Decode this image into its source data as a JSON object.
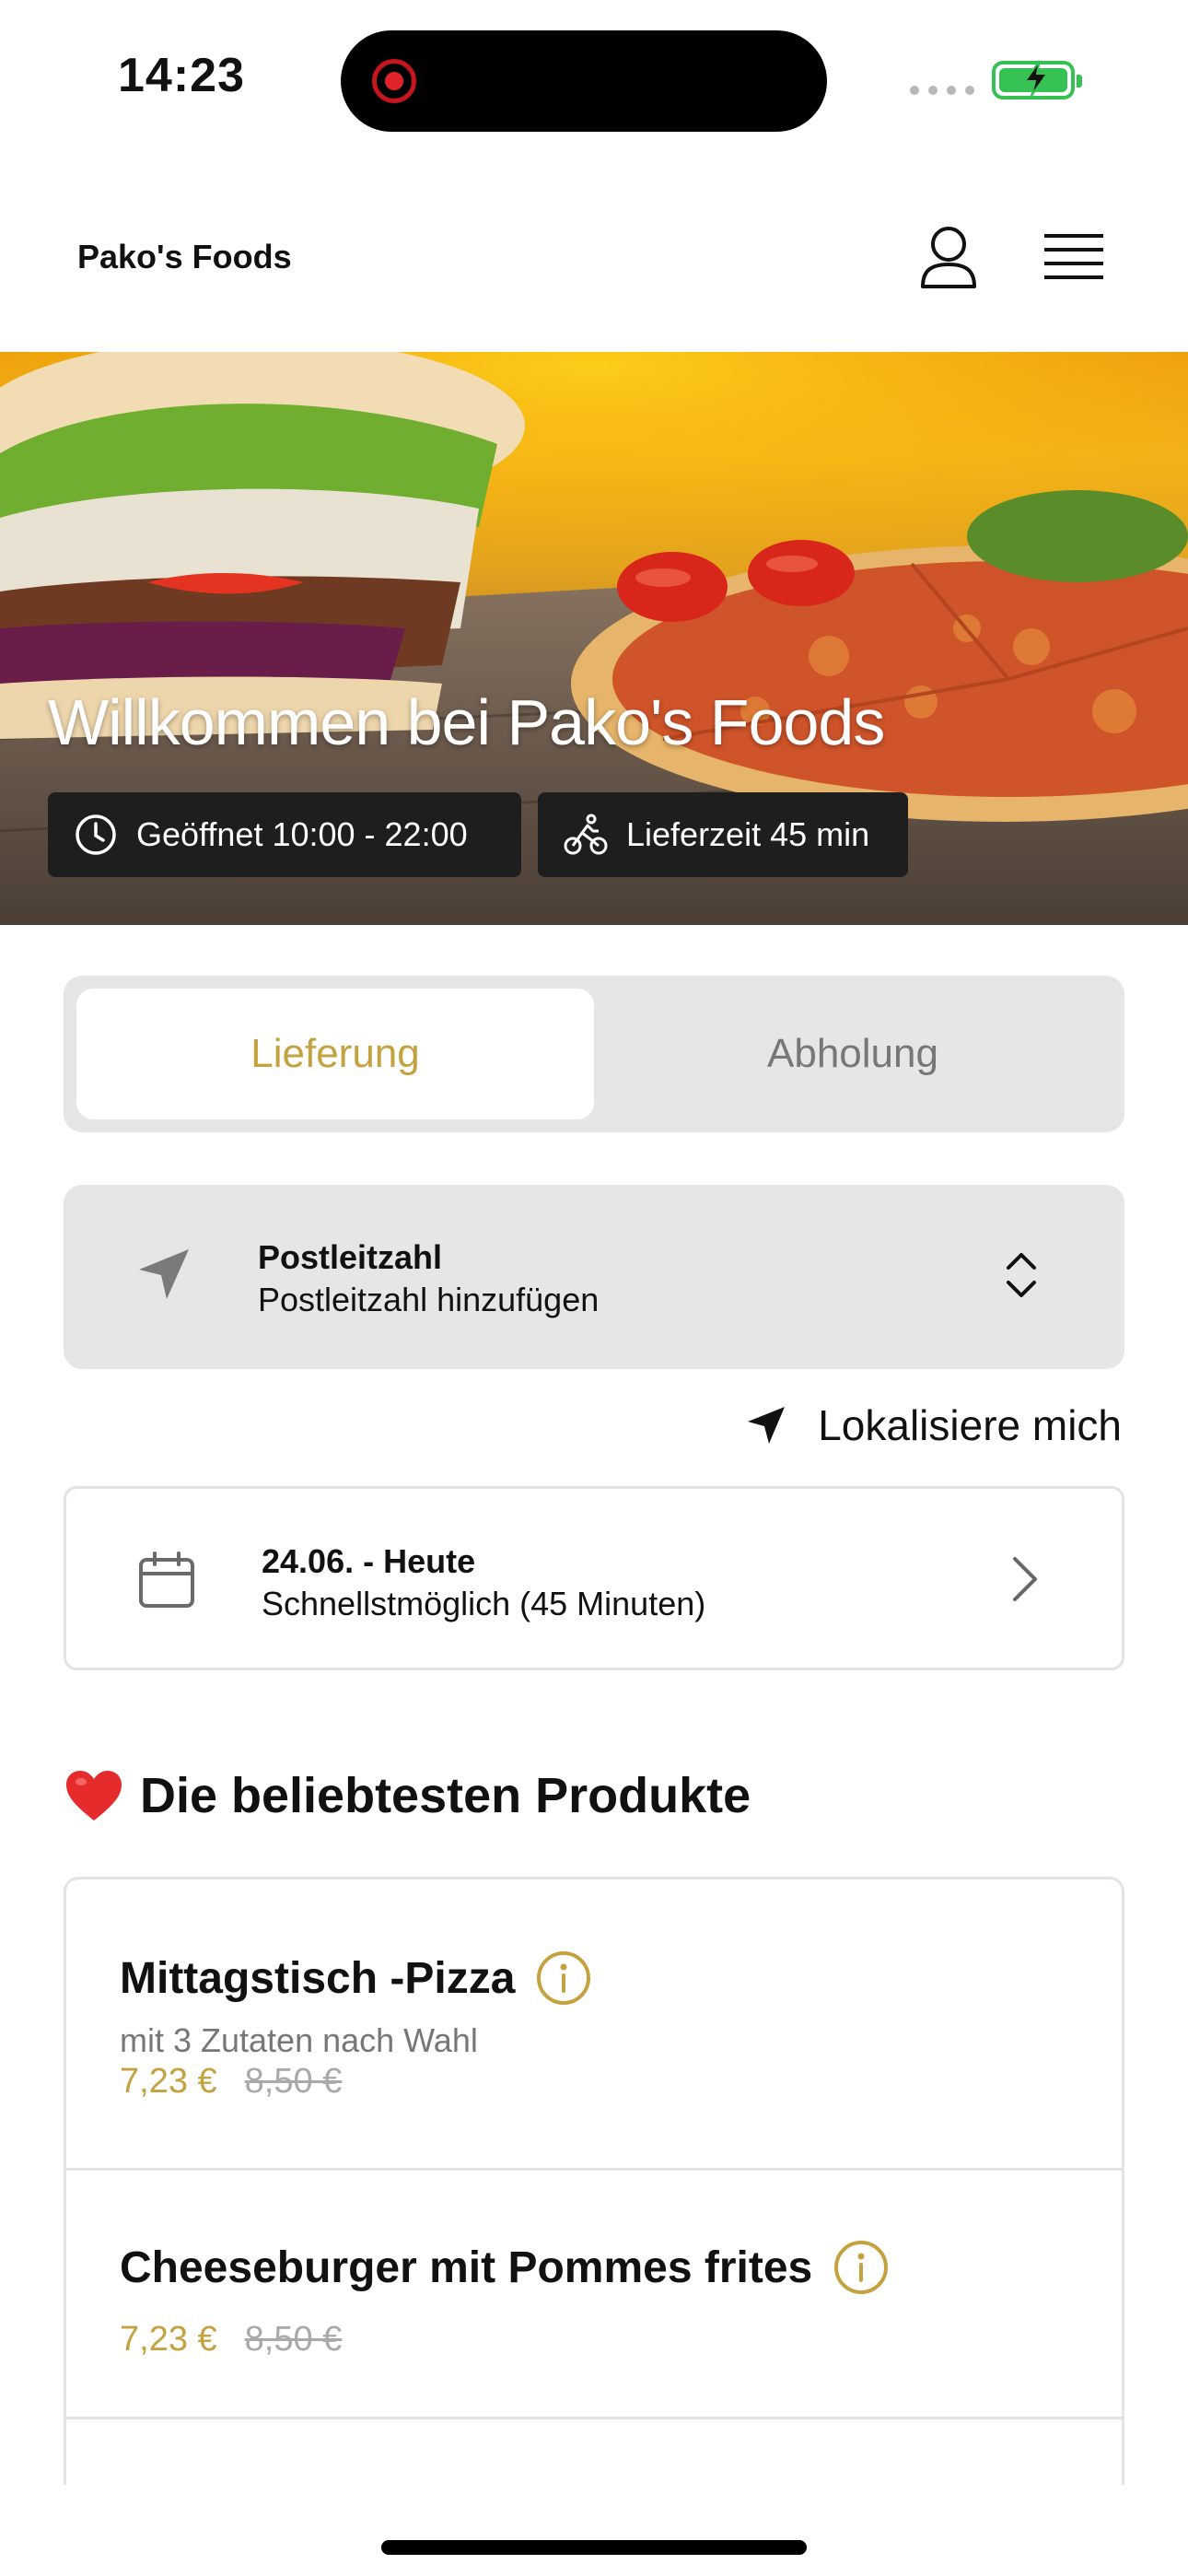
{
  "status_bar": {
    "time": "14:23"
  },
  "header": {
    "brand": "Pako's Foods"
  },
  "hero": {
    "title": "Willkommen bei Pako's Foods",
    "opening": "Geöffnet 10:00 - 22:00",
    "delivery_time": "Lieferzeit 45 min"
  },
  "mode": {
    "delivery": "Lieferung",
    "pickup": "Abholung",
    "selected": "Lieferung"
  },
  "postcode": {
    "label": "Postleitzahl",
    "placeholder": "Postleitzahl hinzufügen"
  },
  "locate": {
    "label": "Lokalisiere mich"
  },
  "date": {
    "title": "24.06. - Heute",
    "subtitle": "Schnellstmöglich (45 Minuten)"
  },
  "popular": {
    "title": "Die beliebtesten Produkte",
    "products": [
      {
        "name": "Mittagstisch -Pizza",
        "description": "mit 3 Zutaten nach Wahl",
        "price": "7,23 €",
        "old_price": "8,50 €"
      },
      {
        "name": "Cheeseburger mit Pommes frites",
        "description": "",
        "price": "7,23 €",
        "old_price": "8,50 €"
      }
    ]
  },
  "colors": {
    "accent": "#c3a23f",
    "panel": "#e6e6e6",
    "badge": "#1e1e1e"
  }
}
